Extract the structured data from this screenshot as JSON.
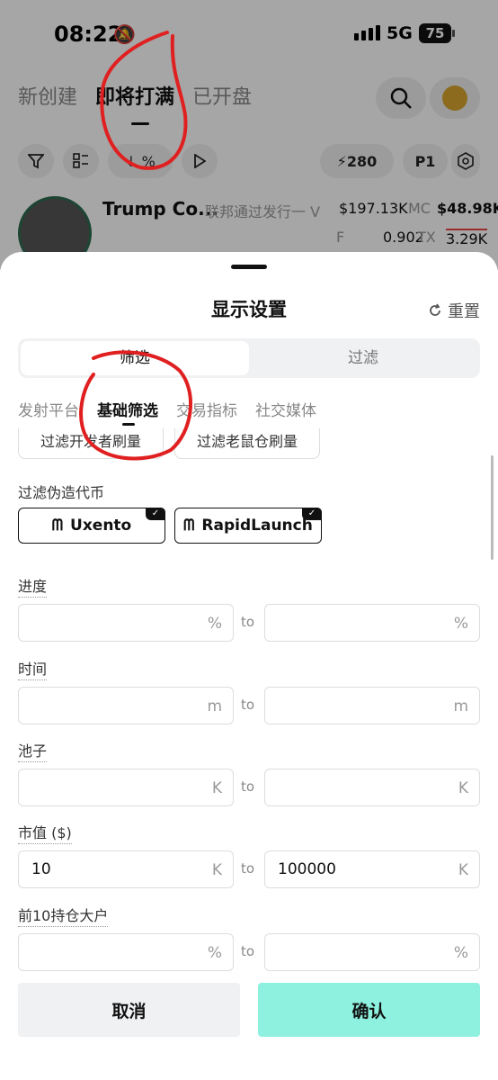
{
  "status_bar": {
    "time": "08:22",
    "network": "5G",
    "battery": "75"
  },
  "top_tabs": [
    "新创建",
    "即将打满",
    "已开盘"
  ],
  "toolbar": {
    "sort_label": "↓ %",
    "count": "280",
    "p_label": "P1"
  },
  "coin": {
    "name": "Trump Co...",
    "subtitle": "联邦通过发行一 V",
    "volume": "$197.13K",
    "mc_label": "MC",
    "mc_value": "$48.98K",
    "f_label": "F",
    "f_value": "0.902",
    "tx_label": "TX",
    "tx_value": "3.29K"
  },
  "sheet": {
    "title": "显示设置",
    "reset_label": "重置",
    "segments": [
      "筛选",
      "过滤"
    ],
    "categories": [
      "发射平台",
      "基础筛选",
      "交易指标",
      "社交媒体"
    ],
    "partial_chips": [
      "过滤开发者刷量",
      "过滤老鼠仓刷量"
    ],
    "fake_token_label": "过滤伪造代币",
    "fake_chips": [
      "Uxento",
      "RapidLaunch"
    ],
    "to_label": "to",
    "ranges": [
      {
        "label": "进度",
        "min": "",
        "max": "",
        "unit": "%"
      },
      {
        "label": "时间",
        "min": "",
        "max": "",
        "unit": "m"
      },
      {
        "label": "池子",
        "min": "",
        "max": "",
        "unit": "K"
      },
      {
        "label": "市值 ($)",
        "min": "10",
        "max": "100000",
        "unit": "K"
      },
      {
        "label": "前10持仓大户",
        "min": "",
        "max": "",
        "unit": "%"
      }
    ],
    "cancel_label": "取消",
    "confirm_label": "确认"
  },
  "colors": {
    "confirm_bg": "#8ef1e0",
    "annotation": "#e02020",
    "check": "#111111"
  }
}
